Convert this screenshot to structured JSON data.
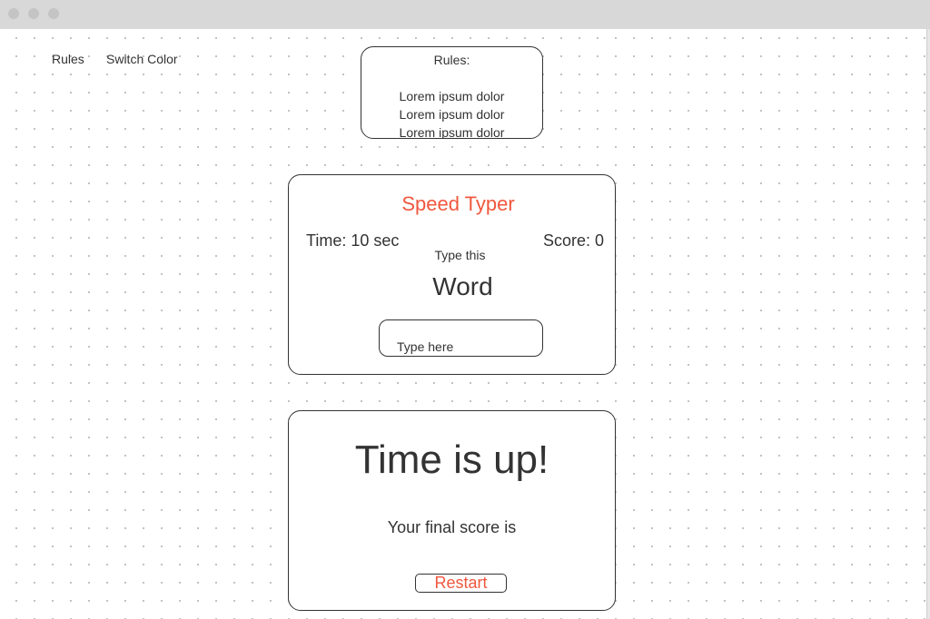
{
  "nav": {
    "rules_label": "Rules",
    "switch_color_label": "Switch Color"
  },
  "rules_panel": {
    "title": "Rules:",
    "lines": [
      "Lorem ipsum dolor",
      "Lorem ipsum dolor",
      "Lorem ipsum dolor"
    ]
  },
  "game": {
    "title": "Speed Typer",
    "time_text": "Time: 10 sec",
    "score_text": "Score: 0",
    "prompt_label": "Type this",
    "word": "Word",
    "input_placeholder": "Type here"
  },
  "result": {
    "title": "Time is up!",
    "score_text": "Your final score is",
    "restart_label": "Restart"
  },
  "colors": {
    "accent": "#f0573e",
    "text": "#333333",
    "titlebar": "#d8d8d8",
    "grid_dot": "#b8b8b8"
  }
}
